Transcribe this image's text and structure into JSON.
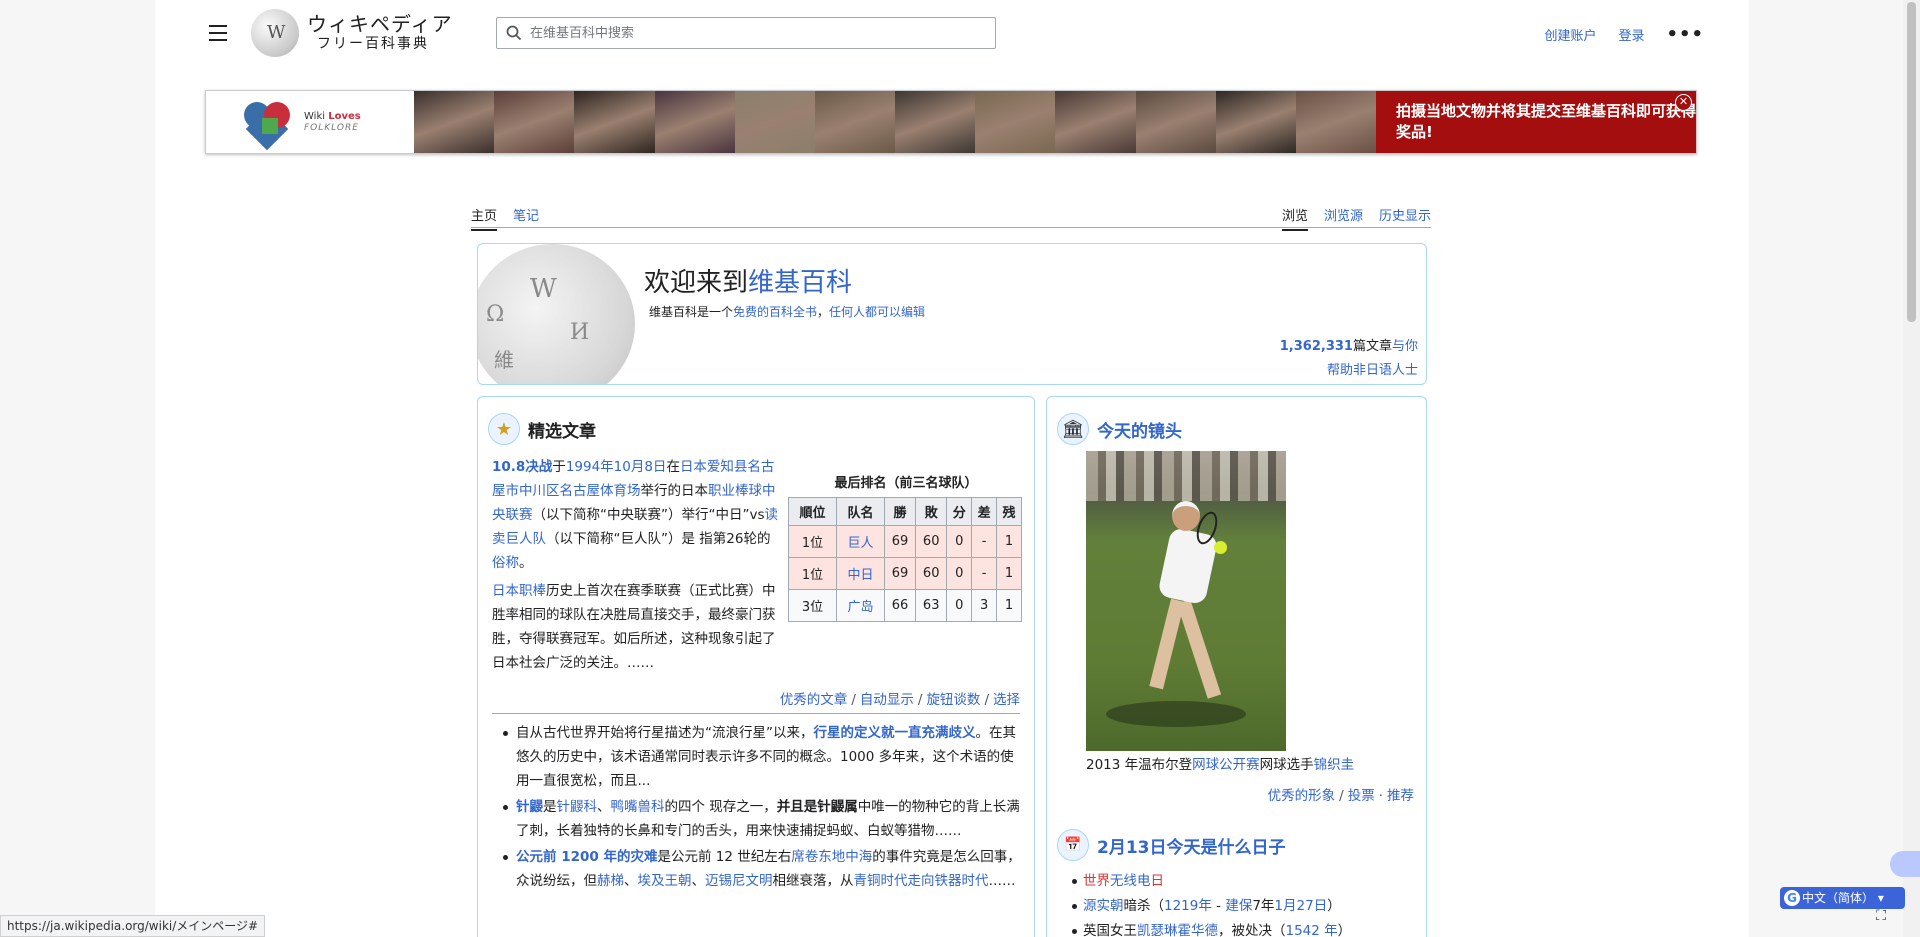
{
  "header": {
    "logo_title": "ウィキペディア",
    "logo_subtitle": "フリー百科事典",
    "search_placeholder": "在维基百科中搜索",
    "create_account": "创建账户",
    "login": "登录",
    "more": "•••"
  },
  "banner": {
    "wlf_line1_a": "Wiki",
    "wlf_line1_b": "Loves",
    "wlf_line2": "FOLKLORE",
    "cta": "拍摄当地文物并将其提交至维基百科即可获得奖品!",
    "close": "✕",
    "photo_colors": [
      "#3a2f2c",
      "#5c3f3a",
      "#2f2520",
      "#4a3540",
      "#8a7f6a",
      "#6b5a48",
      "#3d3733",
      "#7a6850",
      "#4a3a36",
      "#5a4a40",
      "#2e2824",
      "#6a5145"
    ]
  },
  "tabs": {
    "main": "主页",
    "notes": "笔记",
    "view": "浏览",
    "view_source": "浏览源",
    "history": "历史显示"
  },
  "welcome": {
    "title_prefix": "欢迎来到",
    "title_link": "维基百科",
    "tagline_1": "维基百科是一个",
    "tagline_link1": "免费的百科全书",
    "tagline_2": "，",
    "tagline_link2": "任何人都可以编辑",
    "article_count": "1,362,331",
    "article_label": "篇文章",
    "for_you": "与你",
    "help_link": "帮助非日语人士"
  },
  "featured": {
    "title": "精选文章",
    "icon": "★",
    "p1": [
      {
        "t": "10.8决战",
        "l": true,
        "b": true
      },
      {
        "t": "于",
        "l": false
      },
      {
        "t": "1994年10月8日",
        "l": true
      },
      {
        "t": "在",
        "l": false
      },
      {
        "t": "日本爱知县名古屋市中川区名古屋体育场",
        "l": true
      },
      {
        "t": "举行的日本",
        "l": false
      },
      {
        "t": "职业棒球中央联赛",
        "l": true
      },
      {
        "t": "（以下简称“中央联赛”）举行“中日”vs",
        "l": false
      },
      {
        "t": "读卖巨人队",
        "l": true
      },
      {
        "t": "（以下简称“巨人队”）是 指第26轮的",
        "l": false
      },
      {
        "t": "俗称",
        "l": true
      },
      {
        "t": "。",
        "l": false
      }
    ],
    "p2": [
      {
        "t": "日本职棒",
        "l": true
      },
      {
        "t": "历史上首次在赛季联赛（正式比赛）中胜率相同的球队在决胜局直接交手，最终豪门获胜，夺得联赛冠军。如后所述，这种现象引起了日本社会广泛的关注。……",
        "l": false
      }
    ],
    "standings_caption": "最后排名（前三名球队）",
    "standings_headers": [
      "順位",
      "队名",
      "勝",
      "敗",
      "分",
      "差",
      "残"
    ],
    "standings_rows": [
      [
        "1位",
        "巨人",
        "69",
        "60",
        "0",
        "-",
        "1"
      ],
      [
        "1位",
        "中日",
        "69",
        "60",
        "0",
        "-",
        "1"
      ],
      [
        "3位",
        "广岛",
        "66",
        "63",
        "0",
        "3",
        "1"
      ]
    ],
    "links": [
      "优秀的文章",
      "自动显示",
      "旋钮谈数",
      "选择"
    ],
    "items": [
      [
        {
          "t": "自从古代世界开始将行星描述为“流浪行星”以来，",
          "l": false
        },
        {
          "t": "行星的定义就一直充满歧义",
          "l": true,
          "b": true
        },
        {
          "t": "。在其悠久的历史中，该术语通常同时表示许多不同的概念。1000 多年来，这个术语的使用一直很宽松，而且...",
          "l": false
        }
      ],
      [
        {
          "t": "针鼹",
          "l": true,
          "b": true
        },
        {
          "t": "是",
          "l": false
        },
        {
          "t": "针鼹科",
          "l": true
        },
        {
          "t": "、",
          "l": false
        },
        {
          "t": "鸭嘴兽科",
          "l": true
        },
        {
          "t": "的四个 现存之一，",
          "l": false
        },
        {
          "t": "并且是针鼹属",
          "l": false,
          "b": true
        },
        {
          "t": "中唯一的物种它的背上长满了刺，长着独特的长鼻和专门的舌头，用来快速捕捉蚂蚁、白蚁等猎物……",
          "l": false
        }
      ],
      [
        {
          "t": "公元前 1200 年的灾难",
          "l": true,
          "b": true
        },
        {
          "t": "是公元前 12 世纪左右",
          "l": false
        },
        {
          "t": "席卷东地中海",
          "l": true
        },
        {
          "t": "的事件究竟是怎么回事，众说纷纭，但",
          "l": false
        },
        {
          "t": "赫梯",
          "l": true
        },
        {
          "t": "、",
          "l": false
        },
        {
          "t": "埃及王朝",
          "l": true
        },
        {
          "t": "、",
          "l": false
        },
        {
          "t": "迈锡尼文明",
          "l": true
        },
        {
          "t": "相继衰落，从",
          "l": false
        },
        {
          "t": "青铜时代走向铁器时代",
          "l": true
        },
        {
          "t": "……",
          "l": false
        }
      ]
    ]
  },
  "potd": {
    "title": "今天的镜头",
    "icon": "🏛",
    "caption": [
      {
        "t": "2013 年温布尔登",
        "l": false
      },
      {
        "t": "网球公开赛",
        "l": true
      },
      {
        "t": "网球选手",
        "l": false
      },
      {
        "t": "锦织圭",
        "l": true
      }
    ],
    "links": [
      "优秀的形象",
      "投票",
      "推荐"
    ]
  },
  "onthisday": {
    "title": "2月13日今天是什么日子",
    "icon": "📅",
    "items": [
      [
        {
          "t": "世界",
          "l": false,
          "r": true
        },
        {
          "t": "无线电",
          "l": true
        },
        {
          "t": "日",
          "l": false,
          "r": true
        }
      ],
      [
        {
          "t": "源实朝",
          "l": true
        },
        {
          "t": "暗杀（",
          "l": false
        },
        {
          "t": "1219年",
          "l": true
        },
        {
          "t": " - ",
          "l": false
        },
        {
          "t": "建保",
          "l": true
        },
        {
          "t": "7年",
          "l": false
        },
        {
          "t": "1月27日",
          "l": true
        },
        {
          "t": "）",
          "l": false
        }
      ],
      [
        {
          "t": "英国女王",
          "l": false
        },
        {
          "t": "凯瑟琳霍华德",
          "l": true
        },
        {
          "t": "，被处决（",
          "l": false
        },
        {
          "t": "1542 年",
          "l": true
        },
        {
          "t": "）",
          "l": false
        }
      ]
    ]
  },
  "status_url": "https://ja.wikipedia.org/wiki/メインページ#",
  "translate_label": "中文（简体）"
}
